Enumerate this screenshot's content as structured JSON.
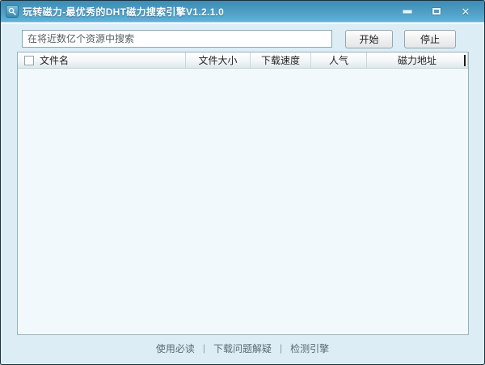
{
  "window": {
    "title": "玩转磁力-最优秀的DHT磁力搜索引擎V1.2.1.0",
    "controls": {
      "close_glyph": "✕"
    }
  },
  "search": {
    "placeholder": "在将近数亿个资源中搜索",
    "value": "",
    "start_label": "开始",
    "stop_label": "停止"
  },
  "table": {
    "columns": [
      {
        "label": "文件名"
      },
      {
        "label": "文件大小"
      },
      {
        "label": "下载速度"
      },
      {
        "label": "人气"
      },
      {
        "label": "磁力地址"
      }
    ],
    "rows": []
  },
  "footer": {
    "links": [
      "使用必读",
      "下载问题解疑",
      "检测引擎"
    ],
    "separator": "|"
  },
  "colors": {
    "titlebar_top": "#3f8bb2",
    "titlebar_bottom": "#62b2d8",
    "content_bg": "#dcedf6",
    "list_bg": "#f2f9fd",
    "frame_border": "#16323f"
  }
}
